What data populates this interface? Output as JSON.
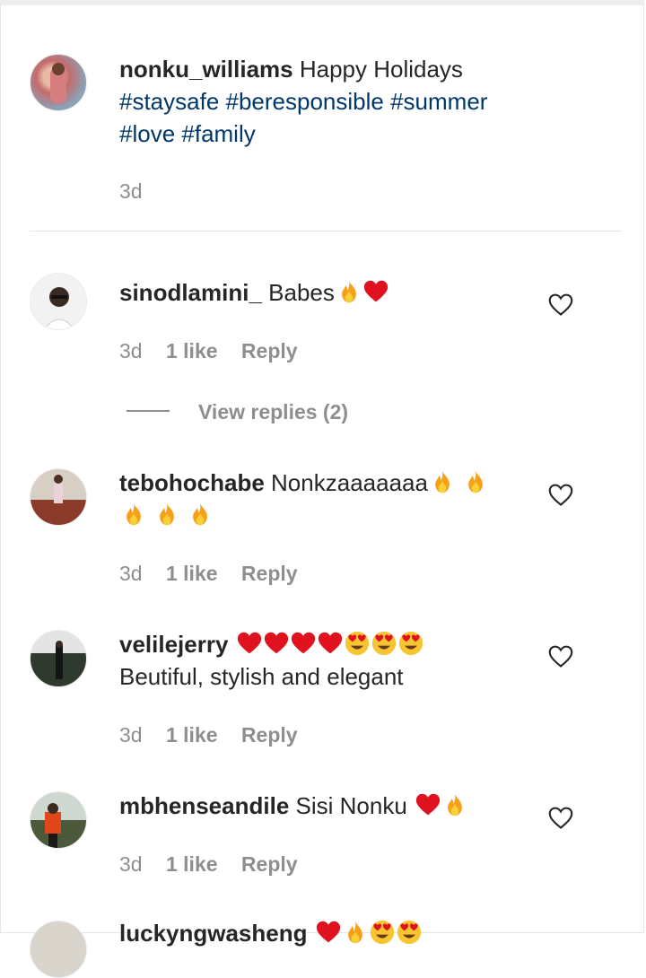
{
  "caption": {
    "username": "nonku_williams",
    "text": "Happy Holidays",
    "hashtags_line1": "#staysafe #beresponsible #summer",
    "hashtags_line2": "#love #family",
    "time": "3d"
  },
  "comments": [
    {
      "username": "sinodlamini_",
      "text": "Babes",
      "emojis": [
        "fire-icon",
        "heart-icon"
      ],
      "time": "3d",
      "likes": "1 like",
      "reply_label": "Reply"
    },
    {
      "username": "tebohochabe",
      "text": "Nonkzaaaaaaa",
      "emojis": [
        "fire-icon",
        "fire-icon",
        "fire-icon",
        "fire-icon",
        "fire-icon"
      ],
      "time": "3d",
      "likes": "1 like",
      "reply_label": "Reply"
    },
    {
      "username": "velilejerry",
      "text": "Beutiful, stylish and elegant",
      "emojis": [
        "heart-icon",
        "heart-icon",
        "heart-icon",
        "heart-icon",
        "heart-eyes-icon",
        "heart-eyes-icon",
        "heart-eyes-icon"
      ],
      "time": "3d",
      "likes": "1 like",
      "reply_label": "Reply"
    },
    {
      "username": "mbhenseandile",
      "text": "Sisi Nonku",
      "emojis": [
        "heart-icon",
        "fire-icon"
      ],
      "time": "3d",
      "likes": "1 like",
      "reply_label": "Reply"
    },
    {
      "username": "luckyngwasheng",
      "text": "",
      "emojis": [
        "heart-icon",
        "fire-icon",
        "heart-eyes-icon",
        "heart-eyes-icon"
      ]
    }
  ],
  "view_replies": "View replies (2)",
  "colors": {
    "hashtag": "#00376b",
    "meta": "#8e8e8e",
    "heart": "#e0121f",
    "fire": "#f6a01a"
  }
}
